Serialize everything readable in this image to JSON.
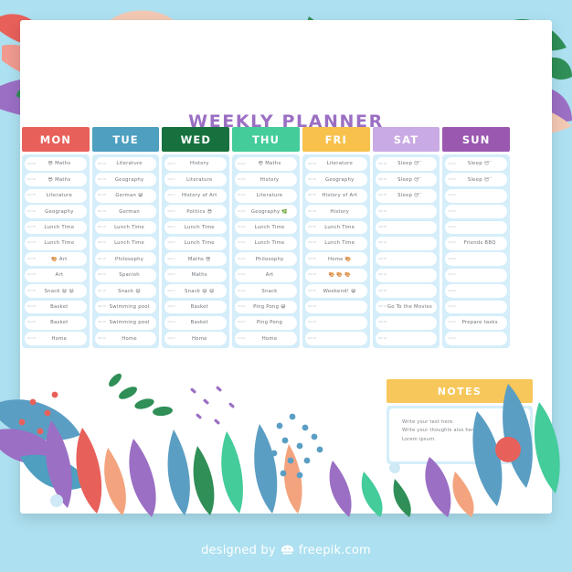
{
  "page": {
    "background_color": "#ade0f0",
    "card_color": "#ffffff",
    "slot_panel_color": "#d5eefa"
  },
  "title": "WEEKLY PLANNER",
  "days": [
    {
      "id": "mon",
      "label": "MON",
      "color": "#e8605a",
      "slots": [
        {
          "time": "00:00",
          "text": "😎 Maths"
        },
        {
          "time": "00:00",
          "text": "😎 Maths"
        },
        {
          "time": "00:00",
          "text": "Literature"
        },
        {
          "time": "00:00",
          "text": "Geography"
        },
        {
          "time": "00:00",
          "text": "Lunch Time"
        },
        {
          "time": "00:00",
          "text": "Lunch Time"
        },
        {
          "time": "00:00",
          "text": "🎨 Art"
        },
        {
          "time": "00:00",
          "text": "Art"
        },
        {
          "time": "00:00",
          "text": "Snack 😄 😄"
        },
        {
          "time": "00:00",
          "text": "Basket"
        },
        {
          "time": "00:00",
          "text": "Basket"
        },
        {
          "time": "00:00",
          "text": "Home"
        }
      ]
    },
    {
      "id": "tue",
      "label": "TUE",
      "color": "#4e9fc0",
      "slots": [
        {
          "time": "00:00",
          "text": "Literature"
        },
        {
          "time": "00:00",
          "text": "Geography"
        },
        {
          "time": "00:00",
          "text": "German 😁"
        },
        {
          "time": "00:00",
          "text": "German"
        },
        {
          "time": "00:00",
          "text": "Lunch Time"
        },
        {
          "time": "00:00",
          "text": "Lunch Time"
        },
        {
          "time": "00:00",
          "text": "Philosophy"
        },
        {
          "time": "00:00",
          "text": "Spanish"
        },
        {
          "time": "00:00",
          "text": "Snack 😄"
        },
        {
          "time": "00:00",
          "text": "Swimming pool"
        },
        {
          "time": "00:00",
          "text": "Swimming pool"
        },
        {
          "time": "00:00",
          "text": "Home"
        }
      ]
    },
    {
      "id": "wed",
      "label": "WED",
      "color": "#16713f",
      "slots": [
        {
          "time": "00:00",
          "text": "History"
        },
        {
          "time": "00:00",
          "text": "Literature"
        },
        {
          "time": "00:00",
          "text": "History of Art"
        },
        {
          "time": "00:00",
          "text": "Politics 😎"
        },
        {
          "time": "00:00",
          "text": "Lunch Time"
        },
        {
          "time": "00:00",
          "text": "Lunch Time"
        },
        {
          "time": "00:00",
          "text": "Maths 😎"
        },
        {
          "time": "00:00",
          "text": "Maths"
        },
        {
          "time": "00:00",
          "text": "Snack 😄 😄"
        },
        {
          "time": "00:00",
          "text": "Basket"
        },
        {
          "time": "00:00",
          "text": "Basket"
        },
        {
          "time": "00:00",
          "text": "Home"
        }
      ]
    },
    {
      "id": "thu",
      "label": "THU",
      "color": "#44cc9b",
      "slots": [
        {
          "time": "00:00",
          "text": "😎 Maths"
        },
        {
          "time": "00:00",
          "text": "History"
        },
        {
          "time": "00:00",
          "text": "Literature"
        },
        {
          "time": "00:00",
          "text": "Geography 🌿"
        },
        {
          "time": "00:00",
          "text": "Lunch Time"
        },
        {
          "time": "00:00",
          "text": "Lunch Time"
        },
        {
          "time": "00:00",
          "text": "Philosophy"
        },
        {
          "time": "00:00",
          "text": "Art"
        },
        {
          "time": "00:00",
          "text": "Snack"
        },
        {
          "time": "00:00",
          "text": "Ping Pong 😁"
        },
        {
          "time": "00:00",
          "text": "Ping Pong"
        },
        {
          "time": "00:00",
          "text": "Home"
        }
      ]
    },
    {
      "id": "fri",
      "label": "FRI",
      "color": "#f7c14c",
      "slots": [
        {
          "time": "00:00",
          "text": "Literature"
        },
        {
          "time": "00:00",
          "text": "Geography"
        },
        {
          "time": "00:00",
          "text": "History of Art"
        },
        {
          "time": "00:00",
          "text": "History"
        },
        {
          "time": "00:00",
          "text": "Lunch Time"
        },
        {
          "time": "00:00",
          "text": "Lunch Time"
        },
        {
          "time": "00:00",
          "text": "Home 🎨"
        },
        {
          "time": "00:00",
          "text": "🎨 🎨 🎨"
        },
        {
          "time": "00:00",
          "text": "Weekend! 😁"
        },
        {
          "time": "00:00",
          "text": ""
        },
        {
          "time": "00:00",
          "text": ""
        },
        {
          "time": "00:00",
          "text": ""
        }
      ]
    },
    {
      "id": "sat",
      "label": "SAT",
      "color": "#c9aae4",
      "slots": [
        {
          "time": "00:00",
          "text": "Sleep 😴"
        },
        {
          "time": "00:00",
          "text": "Sleep 😴"
        },
        {
          "time": "00:00",
          "text": "Sleep 😴"
        },
        {
          "time": "00:00",
          "text": ""
        },
        {
          "time": "00:00",
          "text": ""
        },
        {
          "time": "00:00",
          "text": ""
        },
        {
          "time": "00:00",
          "text": ""
        },
        {
          "time": "00:00",
          "text": ""
        },
        {
          "time": "00:00",
          "text": ""
        },
        {
          "time": "00:00",
          "text": "Go To the Movies"
        },
        {
          "time": "00:00",
          "text": ""
        },
        {
          "time": "00:00",
          "text": ""
        }
      ]
    },
    {
      "id": "sun",
      "label": "SUN",
      "color": "#9b58b0",
      "slots": [
        {
          "time": "00:00",
          "text": "Sleep 😴"
        },
        {
          "time": "00:00",
          "text": "Sleep 😴"
        },
        {
          "time": "00:00",
          "text": ""
        },
        {
          "time": "00:00",
          "text": ""
        },
        {
          "time": "00:00",
          "text": ""
        },
        {
          "time": "00:00",
          "text": "Friends BBQ"
        },
        {
          "time": "00:00",
          "text": ""
        },
        {
          "time": "00:00",
          "text": ""
        },
        {
          "time": "00:00",
          "text": ""
        },
        {
          "time": "00:00",
          "text": ""
        },
        {
          "time": "00:00",
          "text": "Prepare tasks"
        },
        {
          "time": "00:00",
          "text": ""
        }
      ]
    }
  ],
  "notes": {
    "title": "NOTES",
    "lines": [
      "Write your text here.",
      "Write your thoughts also here too.",
      "Lorem ipsum."
    ]
  },
  "credit": {
    "prefix": "designed by",
    "brand": "freepik.com",
    "logo_icon": "freepik-logo-icon"
  }
}
